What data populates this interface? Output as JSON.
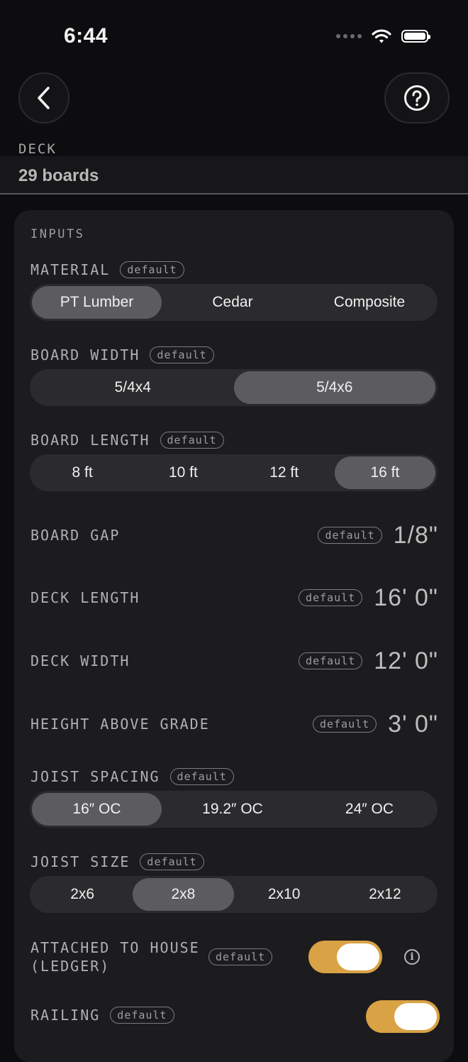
{
  "status_bar": {
    "time": "6:44"
  },
  "header": {
    "section_label": "DECK",
    "summary": "29 boards"
  },
  "inputs": {
    "title": "INPUTS",
    "default_badge": "default",
    "material": {
      "label": "MATERIAL",
      "options": [
        "PT Lumber",
        "Cedar",
        "Composite"
      ],
      "selected": "PT Lumber"
    },
    "board_width": {
      "label": "BOARD WIDTH",
      "options": [
        "5/4x4",
        "5/4x6"
      ],
      "selected": "5/4x6"
    },
    "board_length": {
      "label": "BOARD LENGTH",
      "options": [
        "8 ft",
        "10 ft",
        "12 ft",
        "16 ft"
      ],
      "selected": "16 ft"
    },
    "board_gap": {
      "label": "BOARD GAP",
      "value": "1/8\""
    },
    "deck_length": {
      "label": "DECK LENGTH",
      "value": "16' 0\""
    },
    "deck_width": {
      "label": "DECK WIDTH",
      "value": "12' 0\""
    },
    "height_above_grade": {
      "label": "HEIGHT ABOVE GRADE",
      "value": "3' 0\""
    },
    "joist_spacing": {
      "label": "JOIST SPACING",
      "options": [
        "16″ OC",
        "19.2″ OC",
        "24″ OC"
      ],
      "selected": "16″ OC"
    },
    "joist_size": {
      "label": "JOIST SIZE",
      "options": [
        "2x6",
        "2x8",
        "2x10",
        "2x12"
      ],
      "selected": "2x8"
    },
    "attached_to_house": {
      "label_line1": "ATTACHED TO HOUSE",
      "label_line2": "(LEDGER)",
      "on": true
    },
    "railing": {
      "label": "RAILING",
      "on": true
    }
  },
  "colors": {
    "accent": "#d9a245",
    "background": "#0d0d0f",
    "card": "#1c1c1f"
  },
  "icons": {
    "back": "chevron-left-icon",
    "help": "question-circle-icon",
    "info": "info-circle-icon"
  }
}
